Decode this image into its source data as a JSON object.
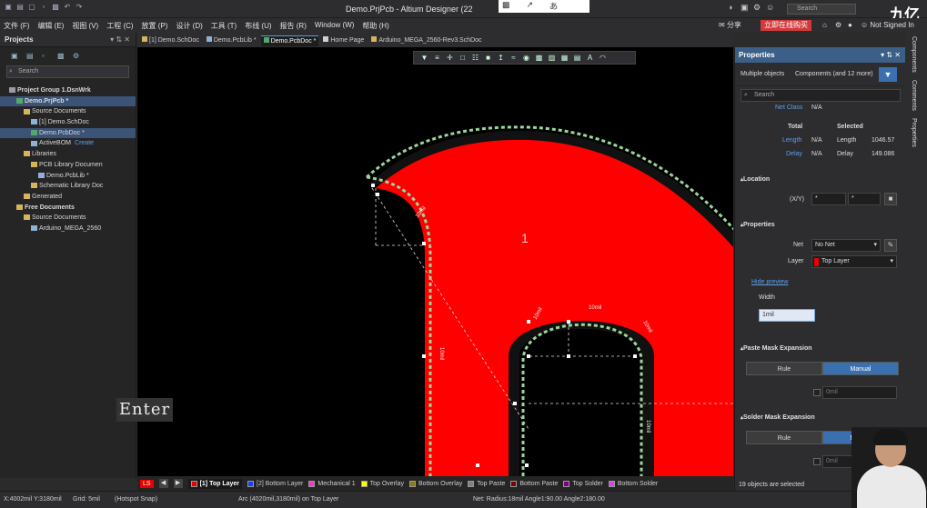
{
  "window": {
    "title": "Demo.PrjPcb - Altium Designer (22",
    "search_placeholder": "Search",
    "sign_in": "Not Signed In",
    "share": "分享",
    "collab": "立即在线购买",
    "watermark": "九亿"
  },
  "menu": {
    "items": [
      "文件 (F)",
      "编辑 (E)",
      "视图 (V)",
      "工程 (C)",
      "放置 (P)",
      "设计 (D)",
      "工具 (T)",
      "布线 (U)",
      "报告 (R)",
      "Window (W)",
      "帮助 (H)"
    ]
  },
  "projects_panel": {
    "title": "Projects",
    "search_placeholder": "Search",
    "tree": [
      {
        "label": "Project Group 1.DsnWrk",
        "indent": 0,
        "icon": "grp",
        "bold": true
      },
      {
        "label": "Demo.PrjPcb *",
        "indent": 1,
        "icon": "pcb",
        "bold": true,
        "selected": true
      },
      {
        "label": "Source Documents",
        "indent": 2,
        "icon": "fold"
      },
      {
        "label": "[1] Demo.SchDoc",
        "indent": 3,
        "icon": "doc"
      },
      {
        "label": "Demo.PcbDoc *",
        "indent": 3,
        "icon": "pcb",
        "selected": true
      },
      {
        "label": "ActiveBOM",
        "indent": 3,
        "icon": "doc",
        "extra": "Create"
      },
      {
        "label": "Libraries",
        "indent": 2,
        "icon": "fold"
      },
      {
        "label": "PCB Library Documen",
        "indent": 3,
        "icon": "fold"
      },
      {
        "label": "Demo.PcbLib *",
        "indent": 4,
        "icon": "doc"
      },
      {
        "label": "Schematic Library Doc",
        "indent": 3,
        "icon": "fold"
      },
      {
        "label": "Generated",
        "indent": 2,
        "icon": "fold"
      },
      {
        "label": "Free Documents",
        "indent": 1,
        "icon": "fold",
        "bold": true
      },
      {
        "label": "Source Documents",
        "indent": 2,
        "icon": "fold"
      },
      {
        "label": "Arduino_MEGA_2560",
        "indent": 3,
        "icon": "doc"
      }
    ]
  },
  "doc_tabs": [
    "[1] Demo.SchDoc",
    "Demo.PcbLib *",
    "Demo.PcbDoc *",
    "Home Page",
    "Arduino_MEGA_2560-Rev3.SchDoc"
  ],
  "canvas": {
    "pad_label": "1",
    "dim_labels": [
      "10mil",
      "10mil",
      "10mil",
      "10mil",
      "10mil",
      "10mil"
    ],
    "enter_overlay": "Enter"
  },
  "layers": {
    "ls": "LS",
    "items": [
      {
        "name": "[1] Top Layer",
        "color": "#e80000",
        "active": true
      },
      {
        "name": "[2] Bottom Layer",
        "color": "#1a3cff"
      },
      {
        "name": "Mechanical 1",
        "color": "#ff33cc"
      },
      {
        "name": "Top Overlay",
        "color": "#ffff00"
      },
      {
        "name": "Bottom Overlay",
        "color": "#8a7a10"
      },
      {
        "name": "Top Paste",
        "color": "#808080"
      },
      {
        "name": "Bottom Paste",
        "color": "#800000"
      },
      {
        "name": "Top Solder",
        "color": "#800080"
      },
      {
        "name": "Bottom Solder",
        "color": "#e040e0"
      }
    ]
  },
  "status": {
    "coords": "X:4002mil Y:3180mil",
    "grid": "Grid: 5mil",
    "snap": "(Hotspot Snap)",
    "arc": "Arc (4020mil,3180mil) on Top Layer",
    "net": "Net:  Radius:18mil Angle1:90.00 Angle2:180.00"
  },
  "properties": {
    "title": "Properties",
    "filter_left": "Multiple objects",
    "filter_right": "Components (and 12 more)",
    "search_placeholder": "Search",
    "net_class_label": "Net Class",
    "net_class_value": "N/A",
    "total_header": "Total",
    "selected_header": "Selected",
    "length_label": "Length",
    "length_total": "N/A",
    "length_sel_label": "Length",
    "length_sel": "1046.57",
    "delay_label": "Delay",
    "delay_total": "N/A",
    "delay_sel_label": "Delay",
    "delay_sel": "149.086",
    "location_section": "Location",
    "xy_label": "(X/Y)",
    "x_value": "*",
    "y_value": "*",
    "properties_section": "Properties",
    "net_label": "Net",
    "net_value": "No Net",
    "layer_label": "Layer",
    "layer_value": "Top Layer",
    "hide_preview": "Hide preview",
    "width_label": "Width",
    "width_value": "1mil",
    "paste_section": "Paste Mask Expansion",
    "paste_rule": "Rule",
    "paste_manual": "Manual",
    "paste_value": "0mil",
    "solder_section": "Solder Mask Expansion",
    "solder_rule": "Rule",
    "solder_manual": "Manual",
    "solder_value": "0mil",
    "footer": "19 objects are selected"
  },
  "side_tabs": [
    "Components",
    "Comments",
    "Properties"
  ]
}
